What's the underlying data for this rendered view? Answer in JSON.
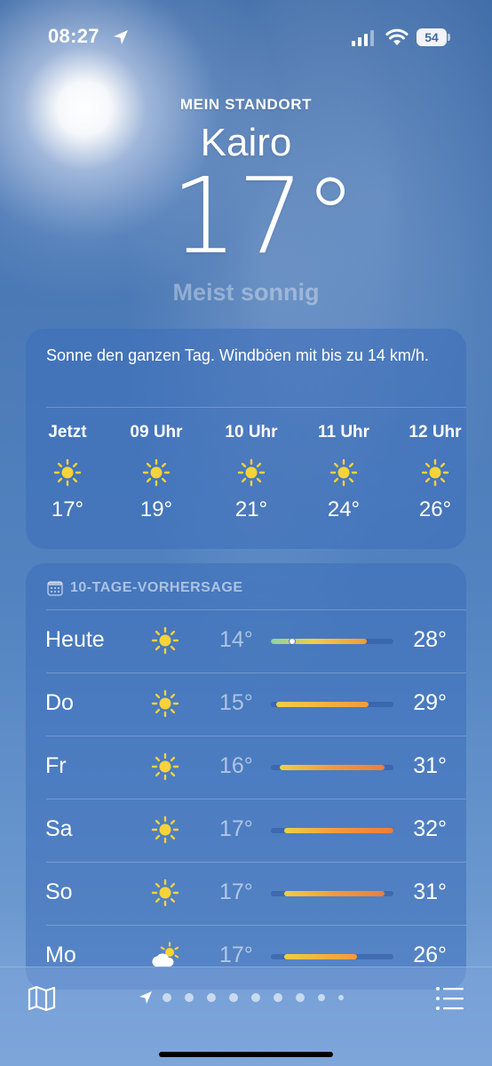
{
  "status_bar": {
    "time": "08:27",
    "battery": "54"
  },
  "header": {
    "location_label": "MEIN STANDORT",
    "city": "Kairo",
    "temperature": "17°",
    "condition": "Meist sonnig"
  },
  "hourly": {
    "summary": "Sonne den ganzen Tag. Windböen mit bis zu 14 km/h.",
    "items": [
      {
        "label": "Jetzt",
        "icon": "sun-icon",
        "temp": "17°"
      },
      {
        "label": "09 Uhr",
        "icon": "sun-icon",
        "temp": "19°"
      },
      {
        "label": "10 Uhr",
        "icon": "sun-icon",
        "temp": "21°"
      },
      {
        "label": "11 Uhr",
        "icon": "sun-icon",
        "temp": "24°"
      },
      {
        "label": "12 Uhr",
        "icon": "sun-icon",
        "temp": "26°"
      }
    ]
  },
  "forecast": {
    "title": "10-TAGE-VORHERSAGE",
    "days": [
      {
        "day": "Heute",
        "icon": "sun-icon",
        "low": "14°",
        "high": "28°",
        "range_start": 0.0,
        "range_end": 0.78,
        "current": 0.17
      },
      {
        "day": "Do",
        "icon": "sun-icon",
        "low": "15°",
        "high": "29°",
        "range_start": 0.04,
        "range_end": 0.8
      },
      {
        "day": "Fr",
        "icon": "sun-icon",
        "low": "16°",
        "high": "31°",
        "range_start": 0.07,
        "range_end": 0.93
      },
      {
        "day": "Sa",
        "icon": "sun-icon",
        "low": "17°",
        "high": "32°",
        "range_start": 0.11,
        "range_end": 1.0
      },
      {
        "day": "So",
        "icon": "sun-icon",
        "low": "17°",
        "high": "31°",
        "range_start": 0.11,
        "range_end": 0.93
      },
      {
        "day": "Mo",
        "icon": "partly-cloudy-icon",
        "low": "17°",
        "high": "26°",
        "range_start": 0.11,
        "range_end": 0.7
      }
    ]
  },
  "colors": {
    "sun": "#f7d33a",
    "bar_cool": "#8fd3a5",
    "bar_mild": "#f0cf45",
    "bar_warm": "#f29a3a",
    "bar_hot": "#ef7d3a"
  }
}
